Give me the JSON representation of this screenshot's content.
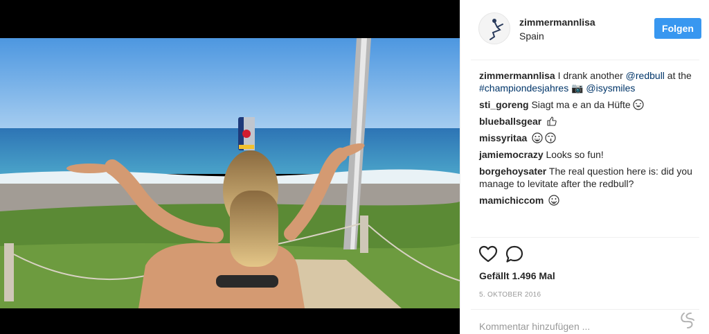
{
  "post": {
    "username": "zimmermannlisa",
    "location": "Spain",
    "follow_label": "Folgen"
  },
  "comments": [
    {
      "user": "zimmermannlisa",
      "segments": [
        {
          "t": "I drank another ",
          "link": false
        },
        {
          "t": "@redbull",
          "link": true
        },
        {
          "t": " at the ",
          "link": false
        },
        {
          "t": "#championdesjahres",
          "link": true
        },
        {
          "t": " 📷 ",
          "link": false
        },
        {
          "t": "@isysmiles",
          "link": true
        }
      ]
    },
    {
      "user": "sti_goreng",
      "segments": [
        {
          "t": "Siagt ma e an da Hüfte",
          "link": false
        }
      ],
      "emoji": [
        "laugh-face"
      ]
    },
    {
      "user": "blueballsgear",
      "segments": [],
      "emoji": [
        "thumbs-up"
      ]
    },
    {
      "user": "missyritaa",
      "segments": [],
      "emoji": [
        "grin-face",
        "kiss-face"
      ]
    },
    {
      "user": "jamiemocrazy",
      "segments": [
        {
          "t": "Looks so fun!",
          "link": false
        }
      ]
    },
    {
      "user": "borgehoysater",
      "segments": [
        {
          "t": "The real question here is: did you manage to levitate after the redbull?",
          "link": false
        }
      ]
    },
    {
      "user": "mamichiccom",
      "segments": [],
      "emoji": [
        "grin-face"
      ]
    }
  ],
  "stats": {
    "likes_label": "Gefällt 1.496 Mal",
    "date": "5. OKTOBER 2016"
  },
  "input": {
    "placeholder": "Kommentar hinzufügen ..."
  },
  "icons": {
    "like": "heart-icon",
    "comment": "speech-bubble-icon",
    "more": "more-options-icon"
  },
  "colors": {
    "follow_button": "#3897f0",
    "link": "#003569"
  }
}
